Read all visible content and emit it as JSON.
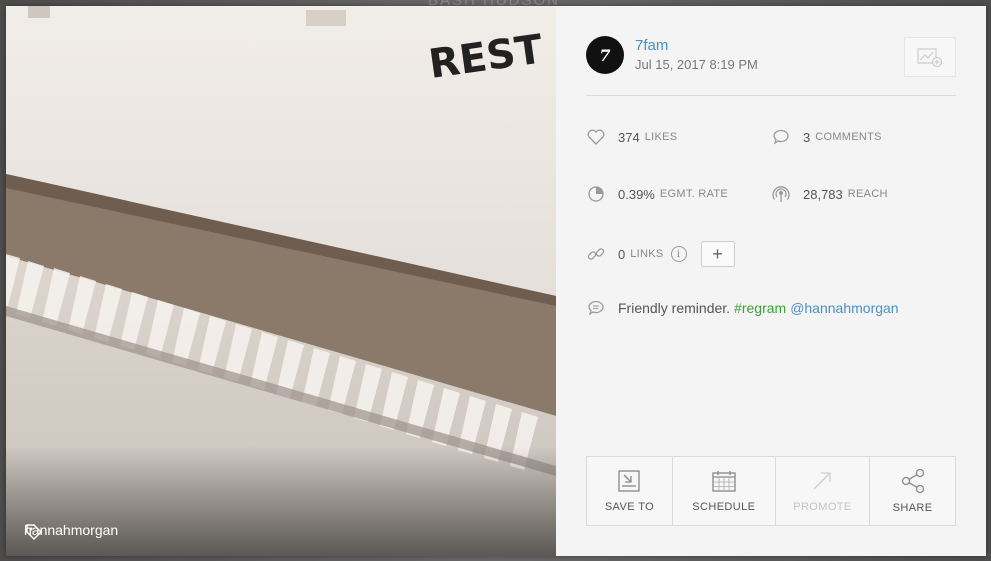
{
  "backdrop": {
    "title": "BASH HUDSON"
  },
  "photo": {
    "sign_text": "REST",
    "tag_icon": "tag-icon",
    "tag_user": "hannahmorgan"
  },
  "post": {
    "avatar_text": "7",
    "account_name": "7fam",
    "date": "Jul 15, 2017 8:19 PM",
    "add_button_icon": "chart-add-icon"
  },
  "stats": {
    "likes": {
      "value": "374",
      "label": "LIKES",
      "icon": "heart-icon"
    },
    "comments": {
      "value": "3",
      "label": "COMMENTS",
      "icon": "comment-icon"
    },
    "engagement": {
      "value": "0.39%",
      "label": "EGMT. RATE",
      "icon": "pie-chart-icon"
    },
    "reach": {
      "value": "28,783",
      "label": "REACH",
      "icon": "broadcast-icon"
    },
    "links": {
      "value": "0",
      "label": "LINKS",
      "icon": "link-icon",
      "info": "i",
      "add": "+"
    }
  },
  "caption": {
    "icon": "speech-bubble-icon",
    "text": "Friendly reminder.",
    "hashtag": "#regram",
    "mention": "@hannahmorgan"
  },
  "actions": [
    {
      "label": "SAVE TO",
      "icon": "save-to-icon",
      "enabled": true
    },
    {
      "label": "SCHEDULE",
      "icon": "calendar-icon",
      "enabled": true
    },
    {
      "label": "PROMOTE",
      "icon": "promote-arrow-icon",
      "enabled": false
    },
    {
      "label": "SHARE",
      "icon": "share-icon",
      "enabled": true
    }
  ],
  "colors": {
    "link_blue": "#4a90c9",
    "hashtag_green": "#3aa335",
    "panel_bg": "#f4f4f4"
  }
}
